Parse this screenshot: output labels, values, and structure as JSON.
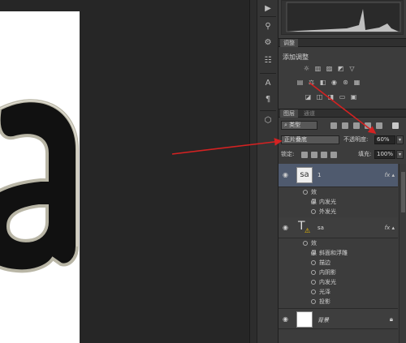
{
  "canvas": {
    "letter_glyph": "a"
  },
  "panels": {
    "adjustments_tab": "调整",
    "adjustments_title": "添加调整",
    "layers_tab": "图层",
    "channels_tab": "通道",
    "filter_kind": "类型",
    "blend_mode": "正片叠底",
    "opacity_label": "不透明度:",
    "opacity_value": "60%",
    "lock_label": "锁定:",
    "fill_label": "填充:",
    "fill_value": "100%"
  },
  "layers": [
    {
      "name": "1",
      "thumb_text": "sa",
      "effects_label": "效果",
      "effects": [
        "内发光",
        "外发光"
      ]
    },
    {
      "name": "sa",
      "thumb_text": "T",
      "effects_label": "效果",
      "effects": [
        "斜面和浮雕",
        "描边",
        "内阴影",
        "内发光",
        "光泽",
        "投影"
      ]
    },
    {
      "name": "背景"
    }
  ],
  "colors": {
    "arrow": "#d42222",
    "selection": "#4f5a6e"
  }
}
